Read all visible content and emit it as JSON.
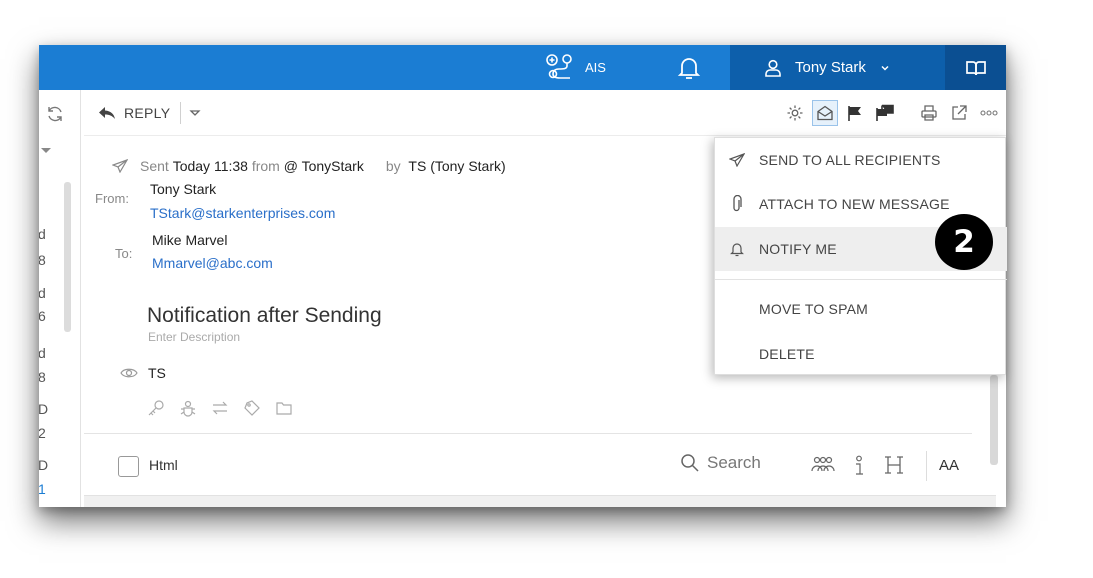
{
  "topbar": {
    "ais_label": "AIS",
    "user_name": "Tony Stark"
  },
  "leftcol": {
    "fragments": [
      "d",
      "8",
      "d",
      "6",
      "d",
      "8",
      "D",
      "2",
      "D",
      "1"
    ]
  },
  "toolbar": {
    "reply_label": "REPLY"
  },
  "message": {
    "sent_prefix": "Sent",
    "sent_when": "Today 11:38",
    "from_word": "from",
    "account": "@ TonyStark",
    "by_word": "by",
    "by_user": "TS (Tony Stark)",
    "from_label": "From:",
    "from_name": "Tony Stark",
    "from_email": "TStark@starkenterprises.com",
    "to_label": "To:",
    "to_name": "Mike Marvel",
    "to_email": "Mmarvel@abc.com",
    "subject": "Notification after Sending",
    "description_placeholder": "Enter Description",
    "viewer": "TS"
  },
  "footer": {
    "html_label": "Html",
    "search_label": "Search",
    "font_size_label": "AA"
  },
  "menu": {
    "items": [
      {
        "label": "SEND TO ALL RECIPIENTS",
        "icon": "send-icon"
      },
      {
        "label": "ATTACH TO NEW MESSAGE",
        "icon": "paperclip-icon"
      },
      {
        "label": "NOTIFY ME",
        "icon": "bell-icon"
      },
      {
        "label": "MOVE TO SPAM",
        "icon": ""
      },
      {
        "label": "DELETE",
        "icon": ""
      }
    ]
  },
  "callout": {
    "number": "2"
  },
  "colors": {
    "topbar": "#1b7dd3",
    "user_panel": "#0d5fab",
    "link": "#2a6fc9"
  }
}
